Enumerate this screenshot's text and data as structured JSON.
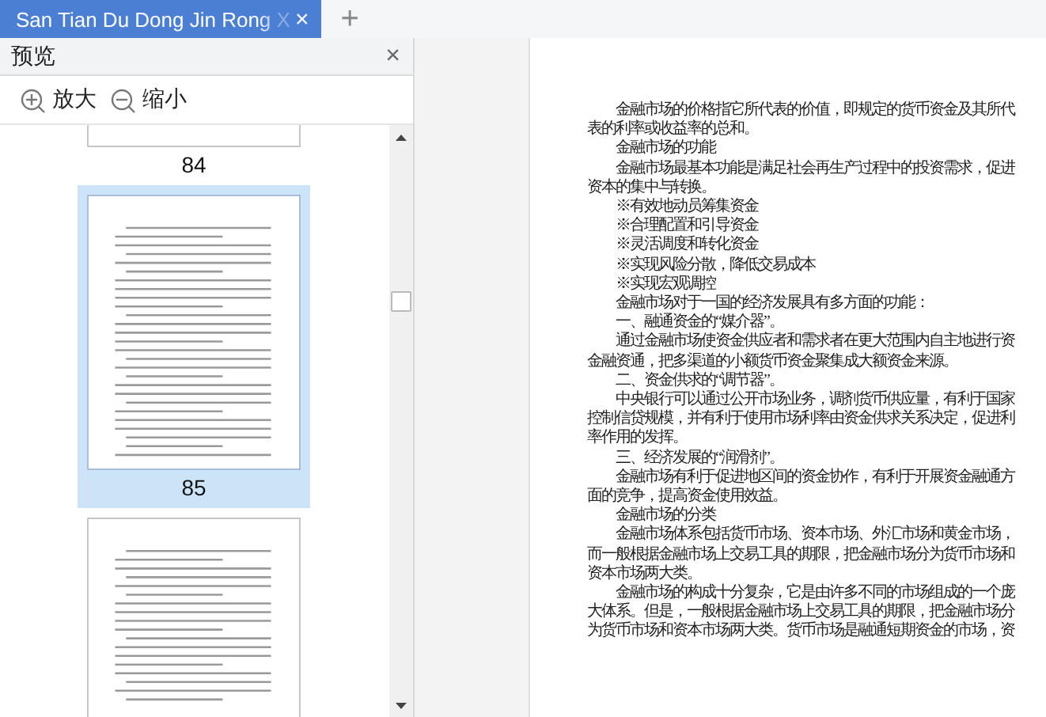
{
  "tab_bar": {
    "tabs": [
      {
        "label": "San Tian Du Dong Jin Rong X",
        "selected": true,
        "close": "×"
      }
    ],
    "new_tab": "+"
  },
  "sidebar": {
    "title": "预览",
    "close": "×",
    "toolbar": [
      {
        "kind": "zoom-in",
        "label": "放大"
      },
      {
        "kind": "zoom-out",
        "label": "缩小"
      }
    ],
    "thumbnails": [
      {
        "page": "84",
        "selected": false
      },
      {
        "page": "85",
        "selected": true
      },
      {
        "selected": false
      }
    ]
  },
  "document": {
    "paragraphs": [
      "金融市场的价格指它所代表的价值，即规定的货币资金及其所代表的利率或收益率的总和。",
      "金融市场的功能",
      "金融市场最基本功能是满足社会再生产过程中的投资需求，促进资本的集中与转换。",
      "※有效地动员筹集资金",
      "※合理配置和引导资金",
      "※灵活调度和转化资金",
      "※实现风险分散，降低交易成本",
      "※实现宏观调控",
      "金融市场对于一国的经济发展具有多方面的功能：",
      "一、融通资金的“媒介器”。",
      "通过金融市场使资金供应者和需求者在更大范围内自主地进行资金融资通，把多渠道的小额货币资金聚集成大额资金来源。",
      "二、资金供求的“调节器”。",
      "中央银行可以通过公开市场业务，调剂货币供应量，有利于国家控制信贷规模，并有利于使用市场利率由资金供求关系决定，促进利率作用的发挥。",
      "三、经济发展的“润滑剂”。",
      "金融市场有利于促进地区间的资金协作，有利于开展资金融通方面的竞争，提高资金使用效益。",
      "金融市场的分类",
      "金融市场体系包括货币市场、资本市场、外汇市场和黄金市场，而一般根据金融市场上交易工具的期限，把金融市场分为货币市场和资本市场两大类。",
      "金融市场的构成十分复杂，它是由许多不同的市场组成的一个庞大体系。但是，一般根据金融市场上交易工具的期限，把金融市场分为货币市场和资本市场两大类。货币市场是融通短期资金的市场，资"
    ]
  }
}
